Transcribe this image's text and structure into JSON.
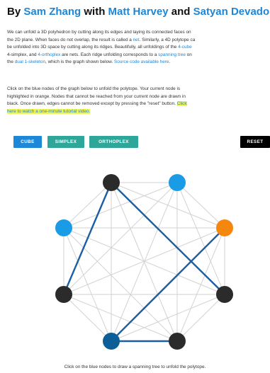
{
  "header": {
    "by": "By ",
    "author1": "Sam Zhang",
    "with": " with ",
    "author2": "Matt Harvey",
    "and": " and ",
    "author3": "Satyan Devadoss"
  },
  "intro": {
    "l1": "We can unfold a 3D polyhedron by cutting along its edges and laying its connected faces on",
    "l2a": "the 2D plane. When faces do not overlap, the result is called a ",
    "l2link": "net",
    "l2b": ". Similarly, a 4D polytope ca",
    "l3a": "be unfolded into 3D space by cutting along its ridges. Beautifully, all unfoldings of the ",
    "l3link": "4-cube",
    "l4a": "4-simplex, and ",
    "l4link": "4-orthoplex",
    "l4b": " are nets. Each ridge unfolding corresponds to a ",
    "l4link2": "spanning tree",
    "l4c": " on",
    "l5a": "the ",
    "l5link": "dual 1-skeleton",
    "l5b": ", which is the graph shown below. ",
    "l5link2": "Source code available here",
    "l5c": "."
  },
  "instructions": {
    "l1": "Click on the blue nodes of the graph below to unfold the polytope. Your current node is",
    "l2": "highlighted in orange. Nodes that cannot be reached from your current node are drawn in",
    "l3a": "black. Once drawn, edges cannot be removed except by pressing the \"reset\" button. ",
    "l3hl": "Click",
    "l4hl": "here to watch a one-minute tutorial video."
  },
  "buttons": {
    "cube": "CUBE",
    "simplex": "SIMPLEX",
    "orthoplex": "ORTHOPLEX",
    "reset": "RESET"
  },
  "colors": {
    "blue_node": "#1a9be6",
    "current_node": "#f5870f",
    "black_node": "#2b2b2b",
    "visited_node": "#0c5f96",
    "tree_edge": "#1b5fa3",
    "graph_edge": "#d2d2d2"
  },
  "graph": {
    "nodes": [
      {
        "id": "n0",
        "state": "black"
      },
      {
        "id": "n1",
        "state": "blue"
      },
      {
        "id": "n2",
        "state": "current"
      },
      {
        "id": "n3",
        "state": "black"
      },
      {
        "id": "n4",
        "state": "black"
      },
      {
        "id": "n5",
        "state": "visited"
      },
      {
        "id": "n6",
        "state": "black"
      },
      {
        "id": "n7",
        "state": "blue"
      }
    ],
    "tree_edges": [
      [
        0,
        6
      ],
      [
        0,
        3
      ],
      [
        5,
        2
      ],
      [
        5,
        4
      ]
    ]
  },
  "caption": "Click on the blue nodes to draw a spanning tree to unfold the polytope."
}
